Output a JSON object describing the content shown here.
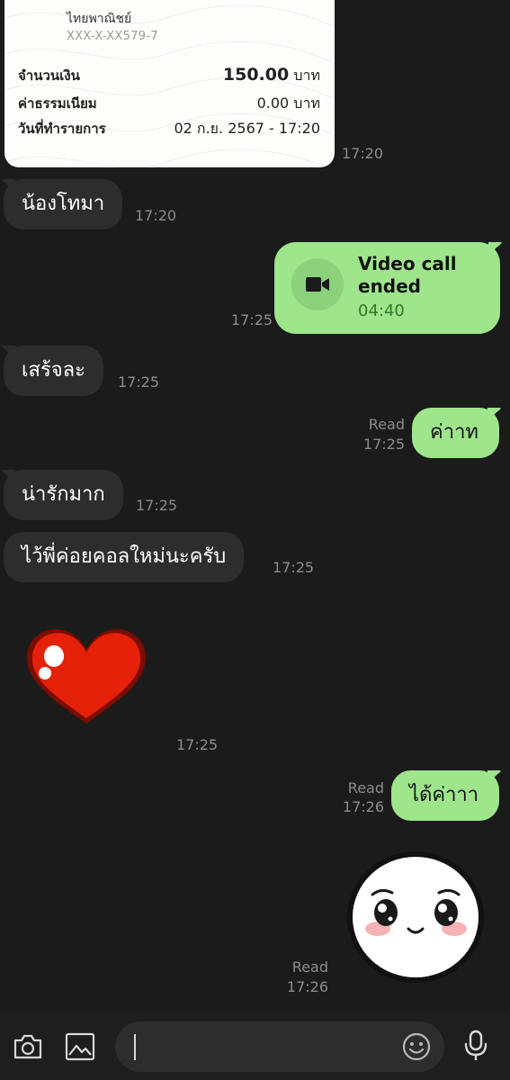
{
  "receipt": {
    "bank_name": "ไทยพาณิชย์",
    "account": "XXX-X-XX579-7",
    "amount_label": "จำนวนเงิน",
    "amount_value": "150.00",
    "amount_unit": "บาท",
    "fee_label": "ค่าธรรมเนียม",
    "fee_value": "0.00 บาท",
    "date_label": "วันที่ทำรายการ",
    "date_value": "02 ก.ย. 2567 - 17:20",
    "time": "17:20"
  },
  "messages": {
    "m1_text": "น้องโทมา",
    "m1_time": "17:20",
    "vcall_title": "Video call ended",
    "vcall_duration": "04:40",
    "vcall_time": "17:25",
    "m2_text": "เสร้จละ",
    "m2_time": "17:25",
    "m3_read": "Read",
    "m3_time": "17:25",
    "m3_text": "ค่าาท",
    "m4_text": "น่ารักมาก",
    "m4_time": "17:25",
    "m5_text": "ไว้พี่ค่อยคอลใหม่นะครับ",
    "m5_time": "17:25",
    "heart_sticker": "heart-sticker",
    "heart_time": "17:25",
    "m6_read": "Read",
    "m6_time": "17:26",
    "m6_text": "ได้ค่าาา",
    "face_sticker": "crying-face-sticker",
    "face_read": "Read",
    "face_time": "17:26"
  },
  "input": {
    "icons": [
      "camera-icon",
      "image-icon",
      "emoji-icon",
      "microphone-icon"
    ]
  },
  "colors": {
    "background": "#1b1b1b",
    "incoming_bubble": "#2d2d2d",
    "outgoing_bubble": "#9ee58c",
    "timestamp": "#8c8c8c"
  }
}
